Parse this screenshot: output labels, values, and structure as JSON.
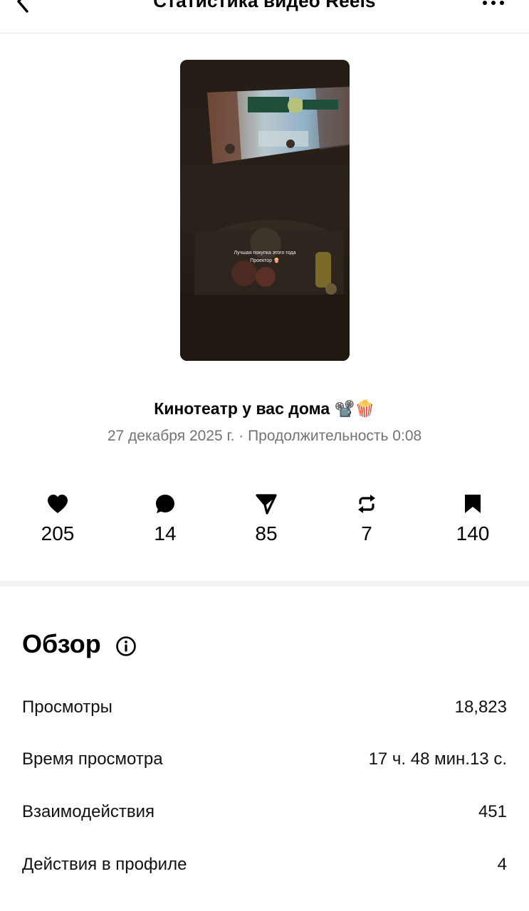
{
  "header": {
    "title": "Статистика видео Reels"
  },
  "reel": {
    "thumbnail_caption_line1": "Лучшая покупка этого года",
    "thumbnail_caption_line2": "Проектор 🍿",
    "title": "Кинотеатр у вас дома 📽️🍿",
    "meta": "27 декабря 2025 г. · Продолжительность 0:08"
  },
  "stats": [
    {
      "icon": "heart-icon",
      "value": "205"
    },
    {
      "icon": "comment-icon",
      "value": "14"
    },
    {
      "icon": "send-icon",
      "value": "85"
    },
    {
      "icon": "repost-icon",
      "value": "7"
    },
    {
      "icon": "bookmark-icon",
      "value": "140"
    }
  ],
  "overview": {
    "title": "Обзор",
    "rows": [
      {
        "label": "Просмотры",
        "value": "18,823"
      },
      {
        "label": "Время просмотра",
        "value": "17 ч. 48 мин.13 с."
      },
      {
        "label": "Взаимодействия",
        "value": "451"
      },
      {
        "label": "Действия в профиле",
        "value": "4"
      }
    ]
  }
}
